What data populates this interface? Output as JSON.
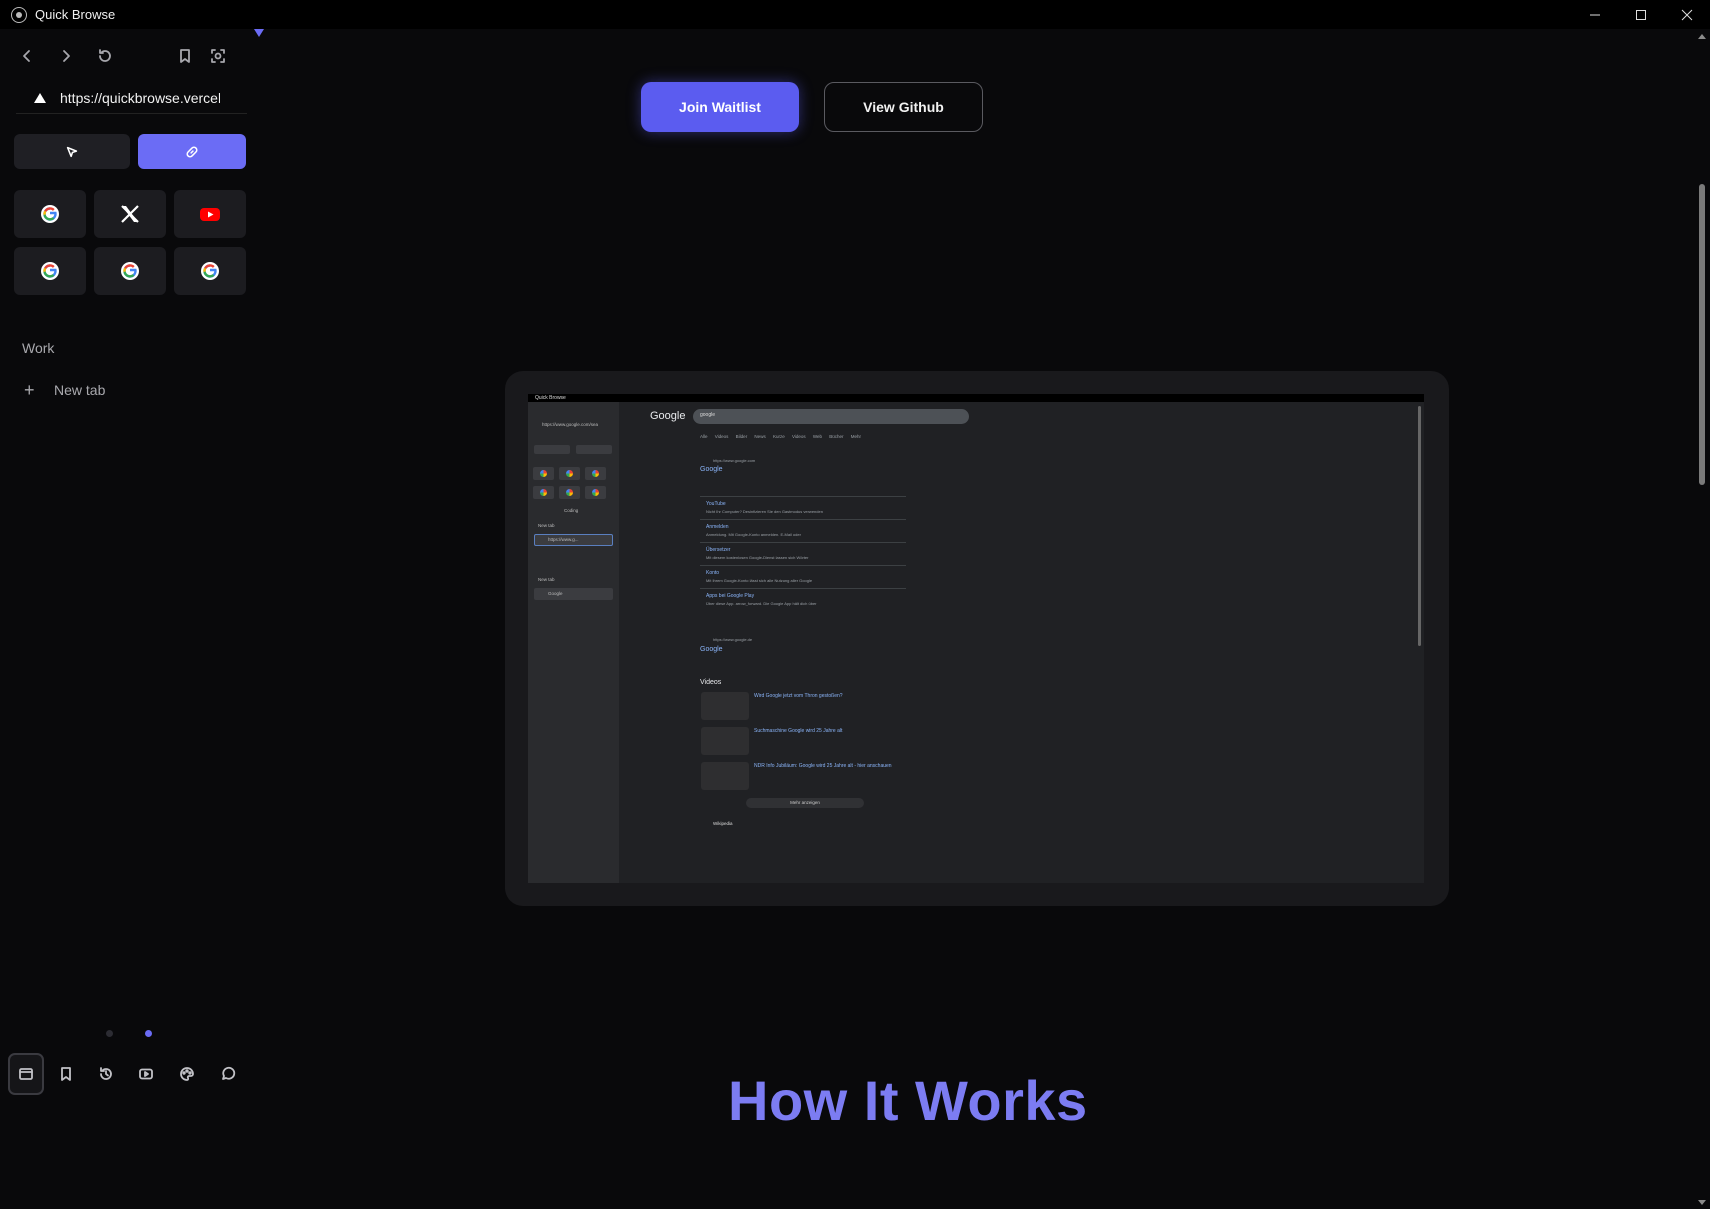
{
  "window": {
    "title": "Quick Browse",
    "controls": [
      "minimize-icon",
      "maximize-icon",
      "close-icon"
    ]
  },
  "sidebar": {
    "nav_icons": [
      "back-icon",
      "forward-icon",
      "reload-icon",
      "bookmark-icon",
      "screenshot-icon"
    ],
    "url": "https://quickbrowse.vercel.app",
    "mode_buttons": [
      {
        "name": "select-mode-button",
        "icon": "cursor-icon",
        "active": false
      },
      {
        "name": "link-mode-button",
        "icon": "link-icon",
        "active": true
      }
    ],
    "favorites": [
      "google-icon",
      "x-icon",
      "youtube-icon",
      "google-icon",
      "google-icon",
      "google-icon"
    ],
    "section_label": "Work",
    "new_tab_label": "New tab",
    "pager": {
      "count": 2,
      "active_index": 1
    },
    "bottom_icons": [
      "tabs-icon",
      "bookmarks-icon",
      "history-icon",
      "video-icon",
      "palette-icon",
      "chat-icon"
    ]
  },
  "main": {
    "join_button": "Join Waitlist",
    "github_button": "View Github",
    "heading": "How It Works",
    "preview": {
      "window_title": "Quick Browse",
      "mini_url": "https://www.google.com/sea",
      "mini_section": "Coding",
      "mini_new_tab": "New tab",
      "mini_tab1": "https://www.g...",
      "mini_new_tab2": "New tab",
      "mini_tab2": "Google",
      "google_logo": "Google",
      "search_query": "google",
      "tabs": "Alle  Videos  Bilder  News  Kurze Videos  Web  Bücher  Mehr",
      "results": [
        {
          "title": "Google",
          "url": "https://www.google.com"
        },
        {
          "title": "YouTube",
          "snippet": "Nicht Ihr Computer? Desinfizieren Sie den Gastmodus verwenden"
        },
        {
          "title": "Anmelden",
          "snippet": "Anmeldung. Mit Google-Konto anmelden. E-Mail oder"
        },
        {
          "title": "Übersetzer",
          "snippet": "Mit diesem kostenlosen Google-Dienst lassen sich Wörter"
        },
        {
          "title": "Konto",
          "snippet": "Mit Ihrem Google-Konto lässt sich alle Nutzung aller Google"
        },
        {
          "title": "Apps bei Google Play",
          "snippet": "Über diese App. arrow_forward. Die Google App hält dich über"
        },
        {
          "title": "Google",
          "url": "https://www.google.de"
        }
      ],
      "videos_label": "Videos",
      "videos": [
        "Wird Google jetzt vom Thron gestoßen?",
        "Suchmaschine Google wird 25 Jahre alt",
        "NDR Info Jubiläum: Google wird 25 Jahre alt - hier anschauen"
      ],
      "more_label": "Mehr anzeigen",
      "wiki": "Wikipedia"
    }
  },
  "colors": {
    "accent": "#6b6cf5",
    "background": "#09090b",
    "heading": "#7c7cf2"
  }
}
